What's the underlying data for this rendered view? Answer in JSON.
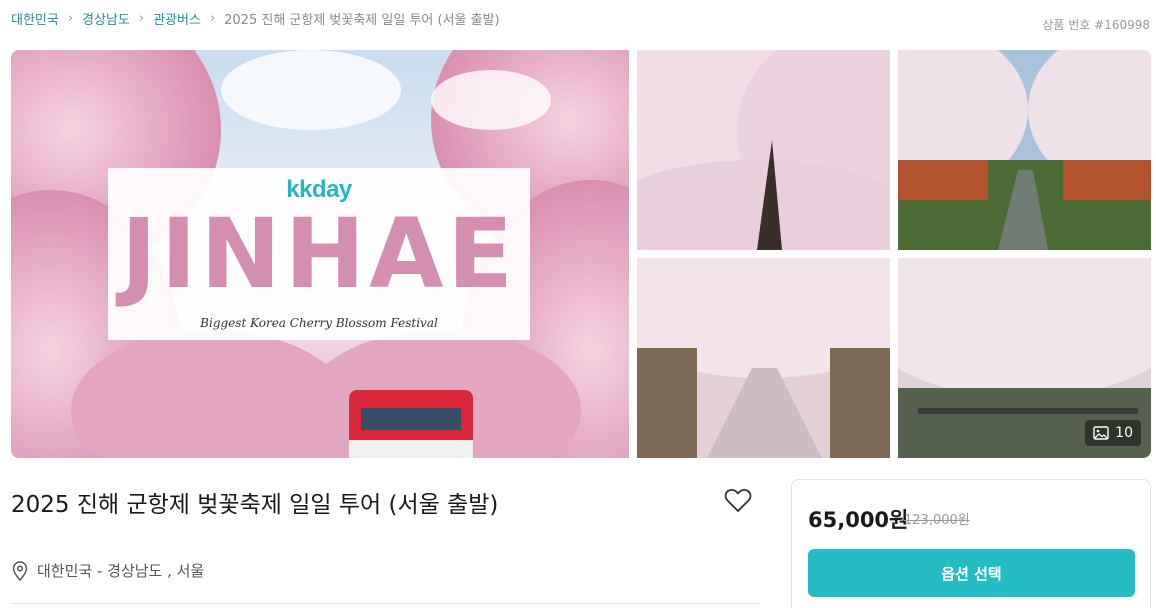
{
  "breadcrumb": {
    "items": [
      "대한민국",
      "경상남도",
      "관광버스"
    ],
    "current": "2025 진해 군항제 벚꽃축제 일일 투어 (서울 출발)"
  },
  "product_number": "상품 번호 #160998",
  "gallery": {
    "main": {
      "brand": "kkday",
      "headline": "JINHAE",
      "tagline": "Biggest Korea Cherry Blossom Festival"
    },
    "photo_count": "10"
  },
  "product": {
    "title": "2025 진해 군항제 벚꽃축제 일일 투어 (서울 출발)",
    "location": "대한민국 - 경상남도 , 서울"
  },
  "pricing": {
    "price": "65,000원",
    "original_price": "123,000원",
    "option_button": "옵션 선택"
  },
  "colors": {
    "accent": "#26bcc6",
    "link": "#2b8a93",
    "blossom": "#e8b4c8"
  }
}
